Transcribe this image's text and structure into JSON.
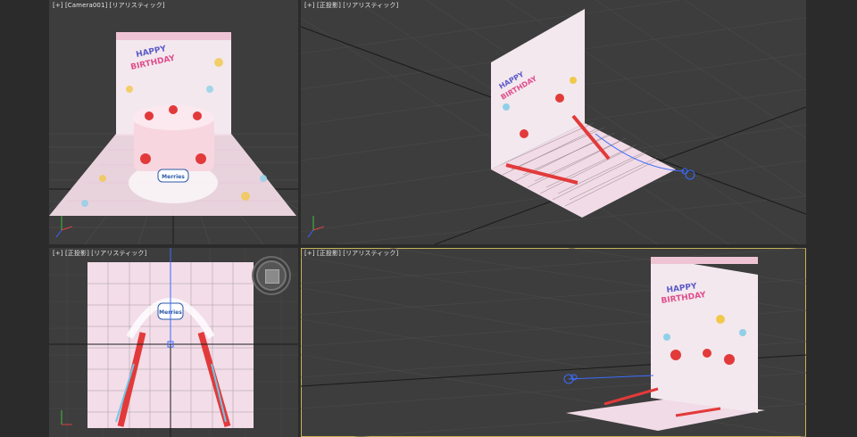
{
  "viewports": [
    {
      "id": "tl",
      "label": "[+] [Camera001] [リアリスティック]"
    },
    {
      "id": "tr",
      "label": "[+] [正投影] [リアリスティック]"
    },
    {
      "id": "bl",
      "label": "[+] [正投影] [リアリスティック]"
    },
    {
      "id": "br",
      "label": "[+] [正投影] [リアリスティック]"
    }
  ],
  "card": {
    "line1": "HAPPY",
    "line2": "BIRTHDAY",
    "badge": "Merries"
  },
  "colors": {
    "grid": "#555555",
    "grid_major": "#1a1a1a",
    "card_bg": "#f3e8ee",
    "floor_bg": "#f1dbe6",
    "active_border": "#c7b35a",
    "spline": "#3b6cff"
  }
}
